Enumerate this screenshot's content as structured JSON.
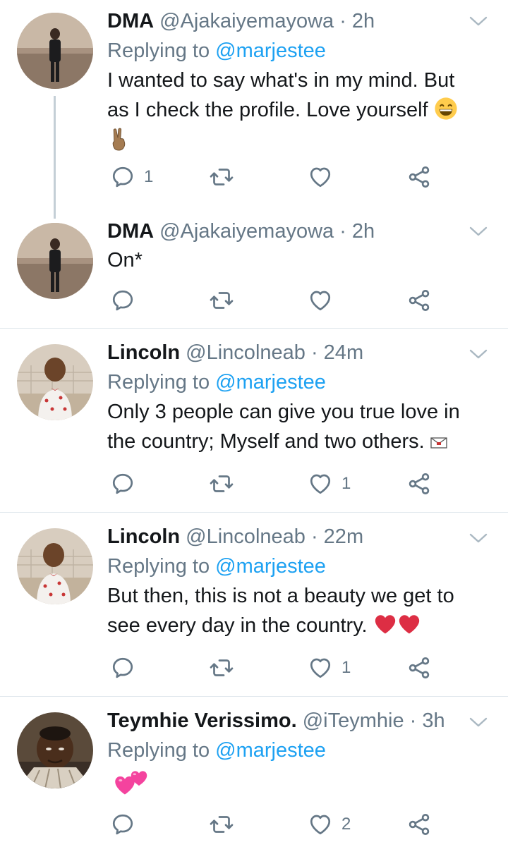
{
  "tweets": [
    {
      "name": "DMA",
      "handle": "@Ajakaiyemayowa",
      "time": "· 2h",
      "replying_prefix": "Replying to",
      "replying_to": "@marjestee",
      "text_line1": "I wanted to say what's in my mind. But",
      "text_line2": "as I check the profile. Love yourself",
      "reply_count": "1",
      "like_count": ""
    },
    {
      "name": "DMA",
      "handle": "@Ajakaiyemayowa",
      "time": "· 2h",
      "text_line1": "On*",
      "reply_count": "",
      "like_count": ""
    },
    {
      "name": "Lincoln",
      "handle": "@Lincolneab",
      "time": "· 24m",
      "replying_prefix": "Replying to",
      "replying_to": "@marjestee",
      "text_line1": "Only 3 people can give you true love in",
      "text_line2": "the country; Myself and two others.",
      "reply_count": "",
      "like_count": "1"
    },
    {
      "name": "Lincoln",
      "handle": "@Lincolneab",
      "time": "· 22m",
      "replying_prefix": "Replying to",
      "replying_to": "@marjestee",
      "text_line1": "But then, this is not a beauty we get to",
      "text_line2": "see every day in the country.",
      "reply_count": "",
      "like_count": "1"
    },
    {
      "name": "Teymhie Verissimo.",
      "handle": "@iTeymhie",
      "time": "· 3h",
      "replying_prefix": "Replying to",
      "replying_to": "@marjestee",
      "reply_count": "",
      "like_count": "2"
    }
  ],
  "colors": {
    "link": "#1da1f2",
    "muted": "#657786",
    "icon": "#657786",
    "separator": "#e1e8ed",
    "heart_emoji": "#e0245e"
  }
}
